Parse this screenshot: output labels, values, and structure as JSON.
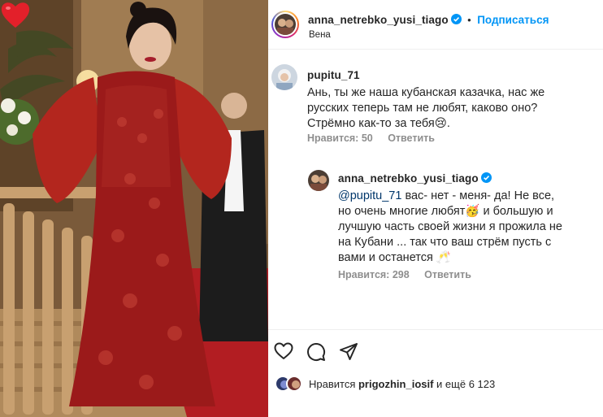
{
  "header": {
    "username": "anna_netrebko_yusi_tiago",
    "dot": "•",
    "follow_label": "Подписаться",
    "location": "Вена"
  },
  "comments": [
    {
      "username": "pupitu_71",
      "lines": [
        "Ань, ты же наша кубанская казачка, нас же",
        "русских теперь там не любят, каково оно?",
        "Стрёмно как-то за тебя😢."
      ],
      "likes_label": "Нравится: 50",
      "reply_label": "Ответить"
    }
  ],
  "reply": {
    "username": "anna_netrebko_yusi_tiago",
    "mention": "@pupitu_71",
    "first_line_rest": " вас- нет - меня- да! Не все,",
    "lines": [
      "но очень многие любят🥳 и большую и",
      "лучшую часть своей жизни я прожила не",
      "на Кубани ... так что ваш стрём пусть с",
      "вами и останется 🥂"
    ],
    "likes_label": "Нравится: 298",
    "reply_label": "Ответить"
  },
  "actions": {
    "like_icon": "heart-outline-icon",
    "comment_icon": "comment-bubble-icon",
    "share_icon": "paper-plane-icon"
  },
  "likes_line": {
    "prefix": "Нравится ",
    "user": "prigozhin_iosif",
    "suffix": " и ещё 6 123"
  },
  "photo": {
    "overlay_icon": "red-heart-emoji",
    "colors": {
      "dress": "#9b1a1a",
      "fur": "#b3261e",
      "background": "#7a5a3a"
    }
  }
}
